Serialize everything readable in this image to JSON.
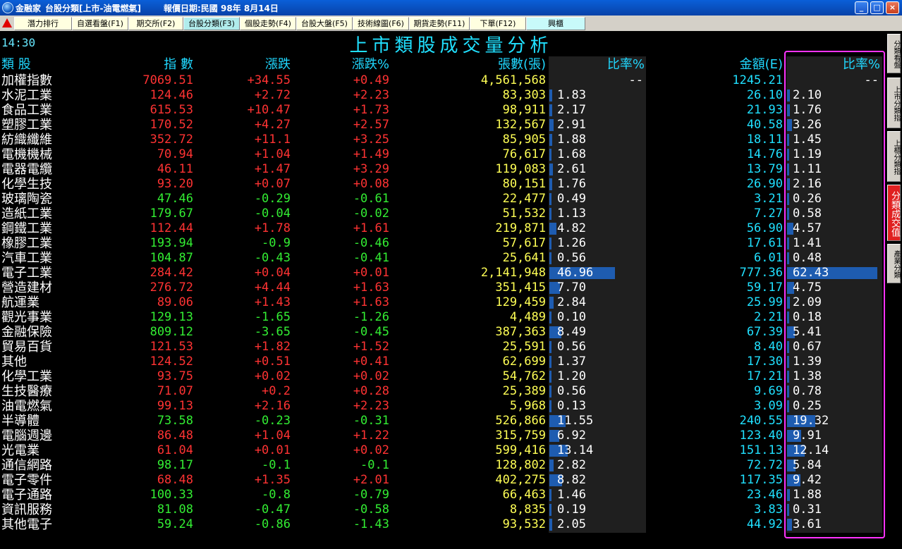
{
  "window": {
    "app_name": "金融家",
    "title_main": "台股分類[上市-油電燃氣]",
    "report_date": "報價日期:民國 98年 8月14日"
  },
  "window_controls": {
    "minimize": "_",
    "maximize": "□",
    "close": "×"
  },
  "toolbar": {
    "buttons": [
      "潛力排行",
      "自選看盤(F1)",
      "期交所(F2)",
      "台股分類(F3)",
      "個股走勢(F4)",
      "台股大盤(F5)",
      "技術線圖(F6)",
      "期貨走勢(F11)",
      "下單(F12)",
      "興櫃"
    ],
    "active_index": 3
  },
  "time": "14:30",
  "page_title": "上市類股成交量分析",
  "columns": {
    "category": "類 股",
    "index": "指 數",
    "change": "漲跌",
    "change_pct": "漲跌%",
    "volume": "張數(張)",
    "volume_ratio": "比率%",
    "amount": "金額(E)",
    "amount_ratio": "比率%"
  },
  "rows": [
    {
      "name": "加權指數",
      "index": "7069.51",
      "change": "+34.55",
      "pct": "+0.49",
      "volume": "4,561,568",
      "vratio": "--",
      "vr": 0,
      "amount": "1245.21",
      "aratio": "--",
      "ar": 0
    },
    {
      "name": "水泥工業",
      "index": "124.46",
      "change": "+2.72",
      "pct": "+2.23",
      "volume": "83,303",
      "vratio": "1.83",
      "vr": 1.83,
      "amount": "26.10",
      "aratio": "2.10",
      "ar": 2.1
    },
    {
      "name": "食品工業",
      "index": "615.53",
      "change": "+10.47",
      "pct": "+1.73",
      "volume": "98,911",
      "vratio": "2.17",
      "vr": 2.17,
      "amount": "21.93",
      "aratio": "1.76",
      "ar": 1.76
    },
    {
      "name": "塑膠工業",
      "index": "170.52",
      "change": "+4.27",
      "pct": "+2.57",
      "volume": "132,567",
      "vratio": "2.91",
      "vr": 2.91,
      "amount": "40.58",
      "aratio": "3.26",
      "ar": 3.26
    },
    {
      "name": "紡織纖維",
      "index": "352.72",
      "change": "+11.1",
      "pct": "+3.25",
      "volume": "85,905",
      "vratio": "1.88",
      "vr": 1.88,
      "amount": "18.11",
      "aratio": "1.45",
      "ar": 1.45
    },
    {
      "name": "電機機械",
      "index": "70.94",
      "change": "+1.04",
      "pct": "+1.49",
      "volume": "76,617",
      "vratio": "1.68",
      "vr": 1.68,
      "amount": "14.76",
      "aratio": "1.19",
      "ar": 1.19
    },
    {
      "name": "電器電纜",
      "index": "46.11",
      "change": "+1.47",
      "pct": "+3.29",
      "volume": "119,083",
      "vratio": "2.61",
      "vr": 2.61,
      "amount": "13.79",
      "aratio": "1.11",
      "ar": 1.11
    },
    {
      "name": "化學生技",
      "index": "93.20",
      "change": "+0.07",
      "pct": "+0.08",
      "volume": "80,151",
      "vratio": "1.76",
      "vr": 1.76,
      "amount": "26.90",
      "aratio": "2.16",
      "ar": 2.16
    },
    {
      "name": "玻璃陶瓷",
      "index": "47.46",
      "change": "-0.29",
      "pct": "-0.61",
      "volume": "22,477",
      "vratio": "0.49",
      "vr": 0.49,
      "amount": "3.21",
      "aratio": "0.26",
      "ar": 0.26
    },
    {
      "name": "造紙工業",
      "index": "179.67",
      "change": "-0.04",
      "pct": "-0.02",
      "volume": "51,532",
      "vratio": "1.13",
      "vr": 1.13,
      "amount": "7.27",
      "aratio": "0.58",
      "ar": 0.58
    },
    {
      "name": "鋼鐵工業",
      "index": "112.44",
      "change": "+1.78",
      "pct": "+1.61",
      "volume": "219,871",
      "vratio": "4.82",
      "vr": 4.82,
      "amount": "56.90",
      "aratio": "4.57",
      "ar": 4.57
    },
    {
      "name": "橡膠工業",
      "index": "193.94",
      "change": "-0.9",
      "pct": "-0.46",
      "volume": "57,617",
      "vratio": "1.26",
      "vr": 1.26,
      "amount": "17.61",
      "aratio": "1.41",
      "ar": 1.41
    },
    {
      "name": "汽車工業",
      "index": "104.87",
      "change": "-0.43",
      "pct": "-0.41",
      "volume": "25,641",
      "vratio": "0.56",
      "vr": 0.56,
      "amount": "6.01",
      "aratio": "0.48",
      "ar": 0.48
    },
    {
      "name": "電子工業",
      "index": "284.42",
      "change": "+0.04",
      "pct": "+0.01",
      "volume": "2,141,948",
      "vratio": "46.96",
      "vr": 46.96,
      "amount": "777.36",
      "aratio": "62.43",
      "ar": 62.43
    },
    {
      "name": "營造建材",
      "index": "276.72",
      "change": "+4.44",
      "pct": "+1.63",
      "volume": "351,415",
      "vratio": "7.70",
      "vr": 7.7,
      "amount": "59.17",
      "aratio": "4.75",
      "ar": 4.75
    },
    {
      "name": "航運業",
      "index": "89.06",
      "change": "+1.43",
      "pct": "+1.63",
      "volume": "129,459",
      "vratio": "2.84",
      "vr": 2.84,
      "amount": "25.99",
      "aratio": "2.09",
      "ar": 2.09
    },
    {
      "name": "觀光事業",
      "index": "129.13",
      "change": "-1.65",
      "pct": "-1.26",
      "volume": "4,489",
      "vratio": "0.10",
      "vr": 0.1,
      "amount": "2.21",
      "aratio": "0.18",
      "ar": 0.18
    },
    {
      "name": "金融保險",
      "index": "809.12",
      "change": "-3.65",
      "pct": "-0.45",
      "volume": "387,363",
      "vratio": "8.49",
      "vr": 8.49,
      "amount": "67.39",
      "aratio": "5.41",
      "ar": 5.41
    },
    {
      "name": "貿易百貨",
      "index": "121.53",
      "change": "+1.82",
      "pct": "+1.52",
      "volume": "25,591",
      "vratio": "0.56",
      "vr": 0.56,
      "amount": "8.40",
      "aratio": "0.67",
      "ar": 0.67
    },
    {
      "name": "其他",
      "index": "124.52",
      "change": "+0.51",
      "pct": "+0.41",
      "volume": "62,699",
      "vratio": "1.37",
      "vr": 1.37,
      "amount": "17.30",
      "aratio": "1.39",
      "ar": 1.39
    },
    {
      "name": "化學工業",
      "index": "93.75",
      "change": "+0.02",
      "pct": "+0.02",
      "volume": "54,762",
      "vratio": "1.20",
      "vr": 1.2,
      "amount": "17.21",
      "aratio": "1.38",
      "ar": 1.38
    },
    {
      "name": "生技醫療",
      "index": "71.07",
      "change": "+0.2",
      "pct": "+0.28",
      "volume": "25,389",
      "vratio": "0.56",
      "vr": 0.56,
      "amount": "9.69",
      "aratio": "0.78",
      "ar": 0.78
    },
    {
      "name": "油電燃氣",
      "index": "99.13",
      "change": "+2.16",
      "pct": "+2.23",
      "volume": "5,968",
      "vratio": "0.13",
      "vr": 0.13,
      "amount": "3.09",
      "aratio": "0.25",
      "ar": 0.25
    },
    {
      "name": "半導體",
      "index": "73.58",
      "change": "-0.23",
      "pct": "-0.31",
      "volume": "526,866",
      "vratio": "11.55",
      "vr": 11.55,
      "amount": "240.55",
      "aratio": "19.32",
      "ar": 19.32
    },
    {
      "name": "電腦週邊",
      "index": "86.48",
      "change": "+1.04",
      "pct": "+1.22",
      "volume": "315,759",
      "vratio": "6.92",
      "vr": 6.92,
      "amount": "123.40",
      "aratio": "9.91",
      "ar": 9.91
    },
    {
      "name": "光電業",
      "index": "61.04",
      "change": "+0.01",
      "pct": "+0.02",
      "volume": "599,416",
      "vratio": "13.14",
      "vr": 13.14,
      "amount": "151.13",
      "aratio": "12.14",
      "ar": 12.14
    },
    {
      "name": "通信網路",
      "index": "98.17",
      "change": "-0.1",
      "pct": "-0.1",
      "volume": "128,802",
      "vratio": "2.82",
      "vr": 2.82,
      "amount": "72.72",
      "aratio": "5.84",
      "ar": 5.84
    },
    {
      "name": "電子零件",
      "index": "68.48",
      "change": "+1.35",
      "pct": "+2.01",
      "volume": "402,275",
      "vratio": "8.82",
      "vr": 8.82,
      "amount": "117.35",
      "aratio": "9.42",
      "ar": 9.42
    },
    {
      "name": "電子通路",
      "index": "100.33",
      "change": "-0.8",
      "pct": "-0.79",
      "volume": "66,463",
      "vratio": "1.46",
      "vr": 1.46,
      "amount": "23.46",
      "aratio": "1.88",
      "ar": 1.88
    },
    {
      "name": "資訊服務",
      "index": "81.08",
      "change": "-0.47",
      "pct": "-0.58",
      "volume": "8,835",
      "vratio": "0.19",
      "vr": 0.19,
      "amount": "3.83",
      "aratio": "0.31",
      "ar": 0.31
    },
    {
      "name": "其他電子",
      "index": "59.24",
      "change": "-0.86",
      "pct": "-1.43",
      "volume": "93,532",
      "vratio": "2.05",
      "vr": 2.05,
      "amount": "44.92",
      "aratio": "3.61",
      "ar": 3.61
    }
  ],
  "side_tabs": [
    "分類看盤",
    "上市分類指",
    "上櫃分類指",
    "分類成交值",
    "產業分類"
  ],
  "side_tab_active": 3,
  "colors": {
    "up": "#ff3333",
    "down": "#33ee33",
    "volume": "#ffff55",
    "amount": "#20e0ff",
    "bar": "#1e5cb0",
    "highlight": "#ff33ff"
  }
}
